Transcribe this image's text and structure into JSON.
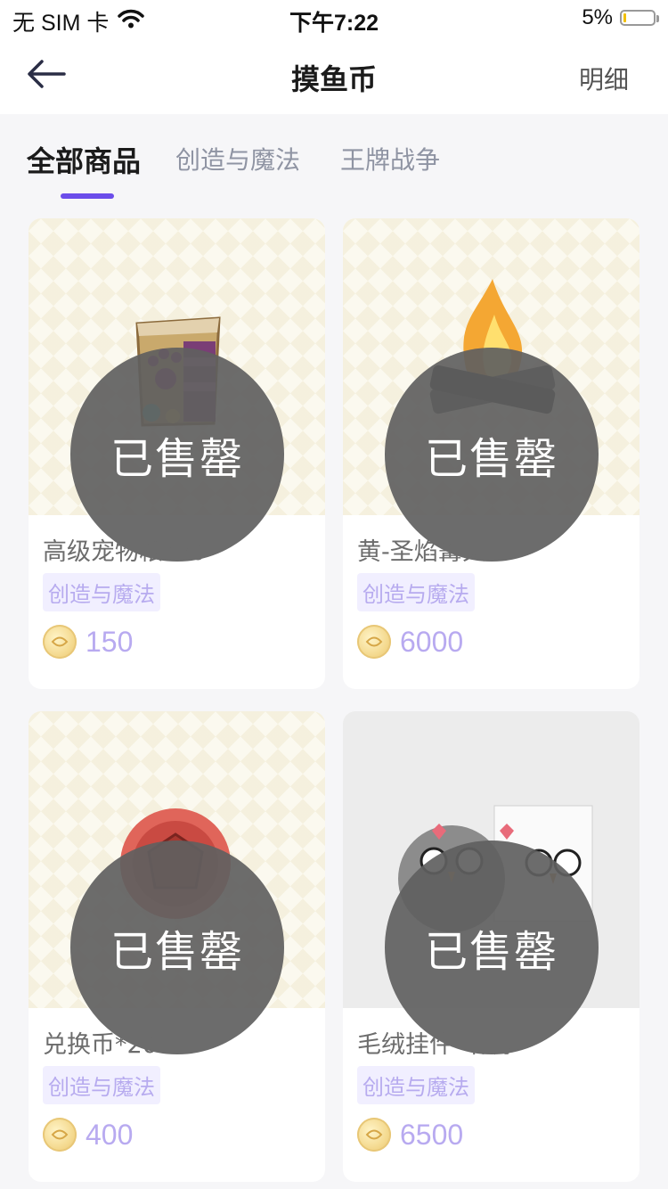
{
  "status_bar": {
    "carrier": "无 SIM 卡",
    "time": "下午7:22",
    "battery": "5%"
  },
  "nav": {
    "title": "摸鱼币",
    "detail_label": "明细",
    "back_icon": "arrow-left-icon"
  },
  "tabs": [
    {
      "label": "全部商品",
      "active": true
    },
    {
      "label": "创造与魔法",
      "active": false
    },
    {
      "label": "王牌战争",
      "active": false
    }
  ],
  "soldout_label": "已售罄",
  "products": [
    {
      "name": "高级宠物粮*20",
      "tag": "创造与魔法",
      "price": "150",
      "image_icon": "pet-food-bag-icon"
    },
    {
      "name": "黄-圣焰篝火",
      "tag": "创造与魔法",
      "price": "6000",
      "image_icon": "bonfire-icon"
    },
    {
      "name": "兑换币*20",
      "tag": "创造与魔法",
      "price": "400",
      "image_icon": "red-coin-icon"
    },
    {
      "name": "毛绒挂件-咕叽",
      "tag": "创造与魔法",
      "price": "6500",
      "image_icon": "plush-bird-icon"
    }
  ],
  "colors": {
    "accent": "#6b4dea",
    "price": "#b8aaf0",
    "tag_bg": "#f1efff",
    "soldout_bg": "#606060"
  }
}
